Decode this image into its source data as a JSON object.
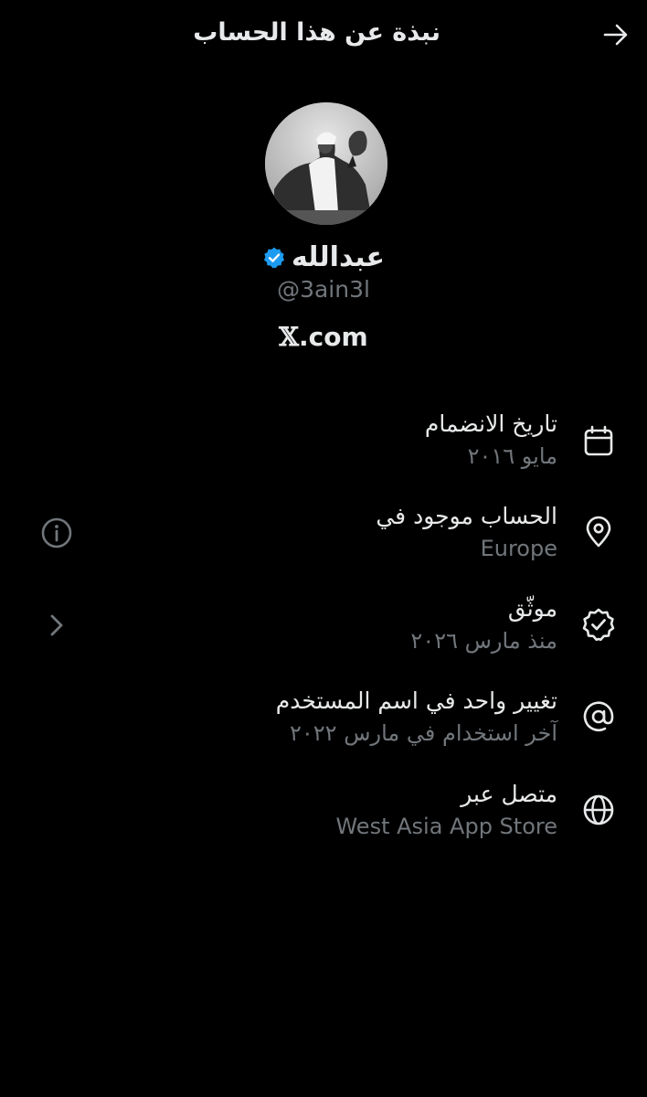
{
  "header": {
    "title": "نبذة عن هذا الحساب",
    "back_icon": "arrow-right-icon"
  },
  "profile": {
    "avatar_icon": "profile-photo",
    "display_name": "عبدالله",
    "verified_icon": "verified-badge-icon",
    "verified_color": "#1d9bf0",
    "handle": "@3ain3l",
    "platform_x": "𝕏",
    "platform_suffix": ".com"
  },
  "details": [
    {
      "icon": "calendar-icon",
      "title": "تاريخ الانضمام",
      "value": "مايو ٢٠١٦"
    },
    {
      "icon": "location-pin-icon",
      "title": "الحساب موجود في",
      "value": "Europe",
      "side_icon": "info-icon"
    },
    {
      "icon": "verified-check-icon",
      "title": "موثّق",
      "value": "منذ مارس ٢٠٢٦",
      "side_icon": "chevron-right-icon"
    },
    {
      "icon": "at-sign-icon",
      "title": "تغيير واحد في اسم المستخدم",
      "value": "آخر استخدام في مارس ٢٠٢٢"
    },
    {
      "icon": "globe-icon",
      "title": "متصل عبر",
      "value": "West Asia App Store"
    }
  ],
  "colors": {
    "background": "#000000",
    "primary_text": "#e7e9ea",
    "secondary_text": "#71767b",
    "icon": "#e7e9ea"
  }
}
